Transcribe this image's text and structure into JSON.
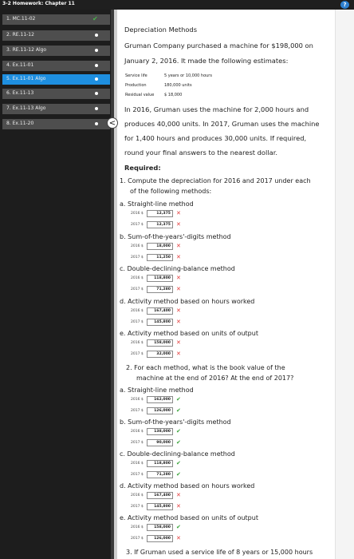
{
  "header": {
    "title": "3-2 Homework: Chapter 11",
    "help_icon": "?"
  },
  "sidebar": {
    "items": [
      {
        "label": "1. MC.11-02",
        "status": "check"
      },
      {
        "label": "2. RE.11-12",
        "status": "dot"
      },
      {
        "label": "3. RE.11-12 Algo",
        "status": "dot"
      },
      {
        "label": "4. Ex.11-01",
        "status": "dot"
      },
      {
        "label": "5. Ex.11-01 Algo",
        "status": "dot"
      },
      {
        "label": "6. Ex.11-13",
        "status": "dot"
      },
      {
        "label": "7. Ex.11-13 Algo",
        "status": "dot"
      },
      {
        "label": "8. Ex.11-20",
        "status": "dot"
      }
    ],
    "collapse_glyph": "<"
  },
  "problem": {
    "title": "Depreciation Methods",
    "intro_1": "Gruman Company purchased a machine for $198,000 on",
    "intro_2": "January 2, 2016. It made the following estimates:",
    "estimates": [
      {
        "label": "Service life",
        "value": "5 years or 10,000 hours"
      },
      {
        "label": "Production",
        "value": "180,000 units"
      },
      {
        "label": "Residual value",
        "value": "$ 18,000"
      }
    ],
    "para_lines": [
      "In 2016, Gruman uses the machine for 2,000 hours and",
      "produces 40,000 units. In 2017, Gruman uses the machine",
      "for 1,400 hours and produces 30,000 units. If required,",
      "round your final answers to the nearest dollar."
    ],
    "required_label": "Required:"
  },
  "q1": {
    "line1": "1.  Compute the depreciation for 2016 and 2017 under each",
    "line2": "of the following methods:",
    "methods": [
      {
        "label": "a.  Straight-line method",
        "rows": [
          {
            "year": "2016 $",
            "value": "12,375",
            "mark": "x"
          },
          {
            "year": "2017 $",
            "value": "12,375",
            "mark": "x"
          }
        ]
      },
      {
        "label": "b.  Sum-of-the-years'-digits method",
        "rows": [
          {
            "year": "2016 $",
            "value": "18,000",
            "mark": "x"
          },
          {
            "year": "2017 $",
            "value": "11,250",
            "mark": "x"
          }
        ]
      },
      {
        "label": "c.  Double-declining-balance method",
        "rows": [
          {
            "year": "2016 $",
            "value": "118,800",
            "mark": "x"
          },
          {
            "year": "2017 $",
            "value": "71,280",
            "mark": "x"
          }
        ]
      },
      {
        "label": "d.  Activity method based on hours worked",
        "rows": [
          {
            "year": "2016 $",
            "value": "167,400",
            "mark": "x"
          },
          {
            "year": "2017 $",
            "value": "145,800",
            "mark": "x"
          }
        ]
      },
      {
        "label": "e.  Activity method based on units of output",
        "rows": [
          {
            "year": "2016 $",
            "value": "158,000",
            "mark": "x"
          },
          {
            "year": "2017 $",
            "value": "32,000",
            "mark": "x"
          }
        ]
      }
    ]
  },
  "q2": {
    "line1": "2.  For each method, what is the book value of the",
    "line2": "machine at the end of 2016? At the end of 2017?",
    "methods": [
      {
        "label": "a.  Straight-line method",
        "rows": [
          {
            "year": "2016 $",
            "value": "162,000",
            "mark": "check"
          },
          {
            "year": "2017 $",
            "value": "126,000",
            "mark": "check"
          }
        ]
      },
      {
        "label": "b.  Sum-of-the-years'-digits method",
        "rows": [
          {
            "year": "2016 $",
            "value": "138,000",
            "mark": "check"
          },
          {
            "year": "2017 $",
            "value": "90,000",
            "mark": "check"
          }
        ]
      },
      {
        "label": "c.  Double-declining-balance method",
        "rows": [
          {
            "year": "2016 $",
            "value": "118,800",
            "mark": "check"
          },
          {
            "year": "2017 $",
            "value": "71,280",
            "mark": "check"
          }
        ]
      },
      {
        "label": "d.  Activity method based on hours worked",
        "rows": [
          {
            "year": "2016 $",
            "value": "167,400",
            "mark": "x"
          },
          {
            "year": "2017 $",
            "value": "145,800",
            "mark": "x"
          }
        ]
      },
      {
        "label": "e.  Activity method based on units of output",
        "rows": [
          {
            "year": "2016 $",
            "value": "158,000",
            "mark": "check"
          },
          {
            "year": "2017 $",
            "value": "126,000",
            "mark": "x"
          }
        ]
      }
    ]
  },
  "q3": {
    "line1": "3.  If Gruman used a service life of 8 years or 15,000 hours"
  }
}
